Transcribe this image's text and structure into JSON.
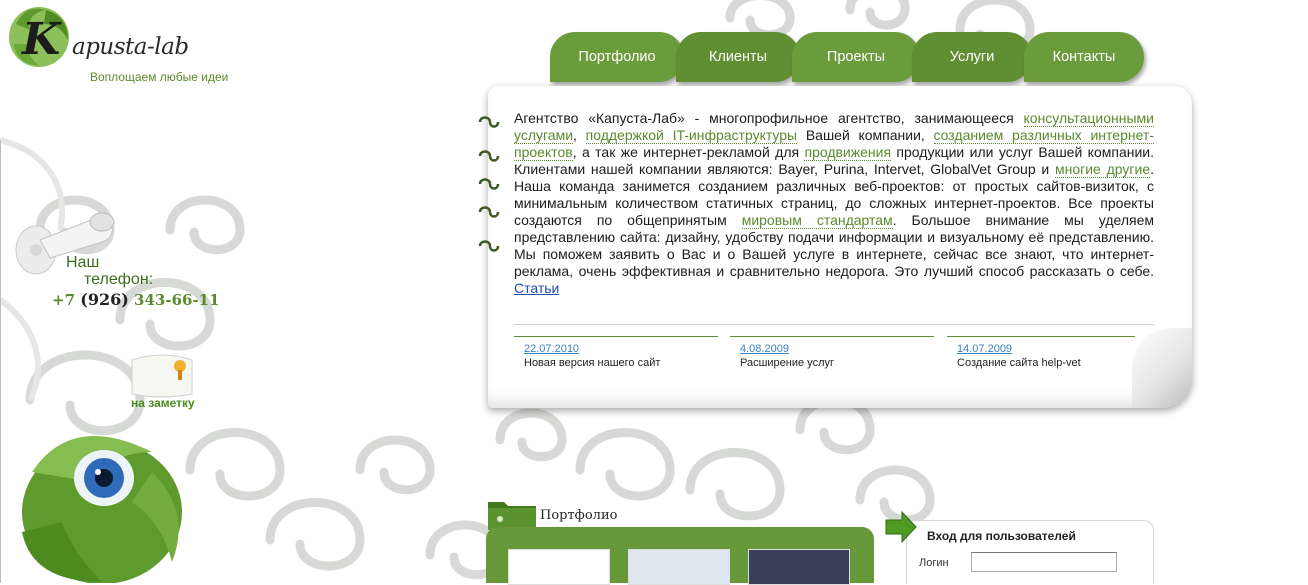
{
  "logo": {
    "title": "apusta-lab",
    "slogan": "Воплощаем любые идеи"
  },
  "nav": {
    "items": [
      {
        "label": "Портфолио"
      },
      {
        "label": "Клиенты"
      },
      {
        "label": "Проекты"
      },
      {
        "label": "Услуги"
      },
      {
        "label": "Контакты"
      }
    ]
  },
  "intro": {
    "t1": "Агентство «Капуста-Лаб» - многопрофильное агентство, занимающееся ",
    "l1": "консультационными услугами",
    "t2": ", ",
    "l2": "поддержкой IT-инфраструктуры",
    "t3": " Вашей компании, ",
    "l3": "созданием различных интернет-проектов",
    "t4": ", а так же интернет-рекламой для ",
    "l4": "продвижения",
    "t5": " продукции или услуг Вашей компании. Клиентами нашей компании являются: Bayer, Purina, Intervet, GlobalVet Group и ",
    "l5": "многие другие",
    "t6": ". Наша команда занимется созданием различных веб-проектов: от простых сайтов-визиток, с минимальным количеством статичных страниц, до сложных интернет-проектов. Все проекты создаются по общепринятым ",
    "l6": "мировым стандартам",
    "t7": ". Большое внимание мы уделяем представлению сайта: дизайну, удобству подачи информации и визуальному её представлению. Мы поможем заявить о Вас и о Вашей услуге в интернете, сейчас все знают, что интернет-реклама, очень эффективная и сравнительно недорога. Это лучший способ рассказать о себе. ",
    "l7": "Статьи"
  },
  "news": [
    {
      "date": "22.07.2010",
      "title": "Новая версия нашего сайт"
    },
    {
      "date": "4.08.2009",
      "title": "Расширение услуг"
    },
    {
      "date": "14.07.2009",
      "title": "Создание сайта help-vet"
    }
  ],
  "phone": {
    "label_line1": "Наш",
    "label_line2": "телефон:",
    "prefix": "+7",
    "code": "(926)",
    "number": "343-66-11"
  },
  "note": {
    "label": "на заметку"
  },
  "portfolio": {
    "title": "Портфолио"
  },
  "login": {
    "title": "Вход для пользователей",
    "login_label": "Логин"
  },
  "colors": {
    "green": "#6a9b3b",
    "green_dark": "#3b6e1c",
    "link_blue": "#1b4fb3"
  }
}
